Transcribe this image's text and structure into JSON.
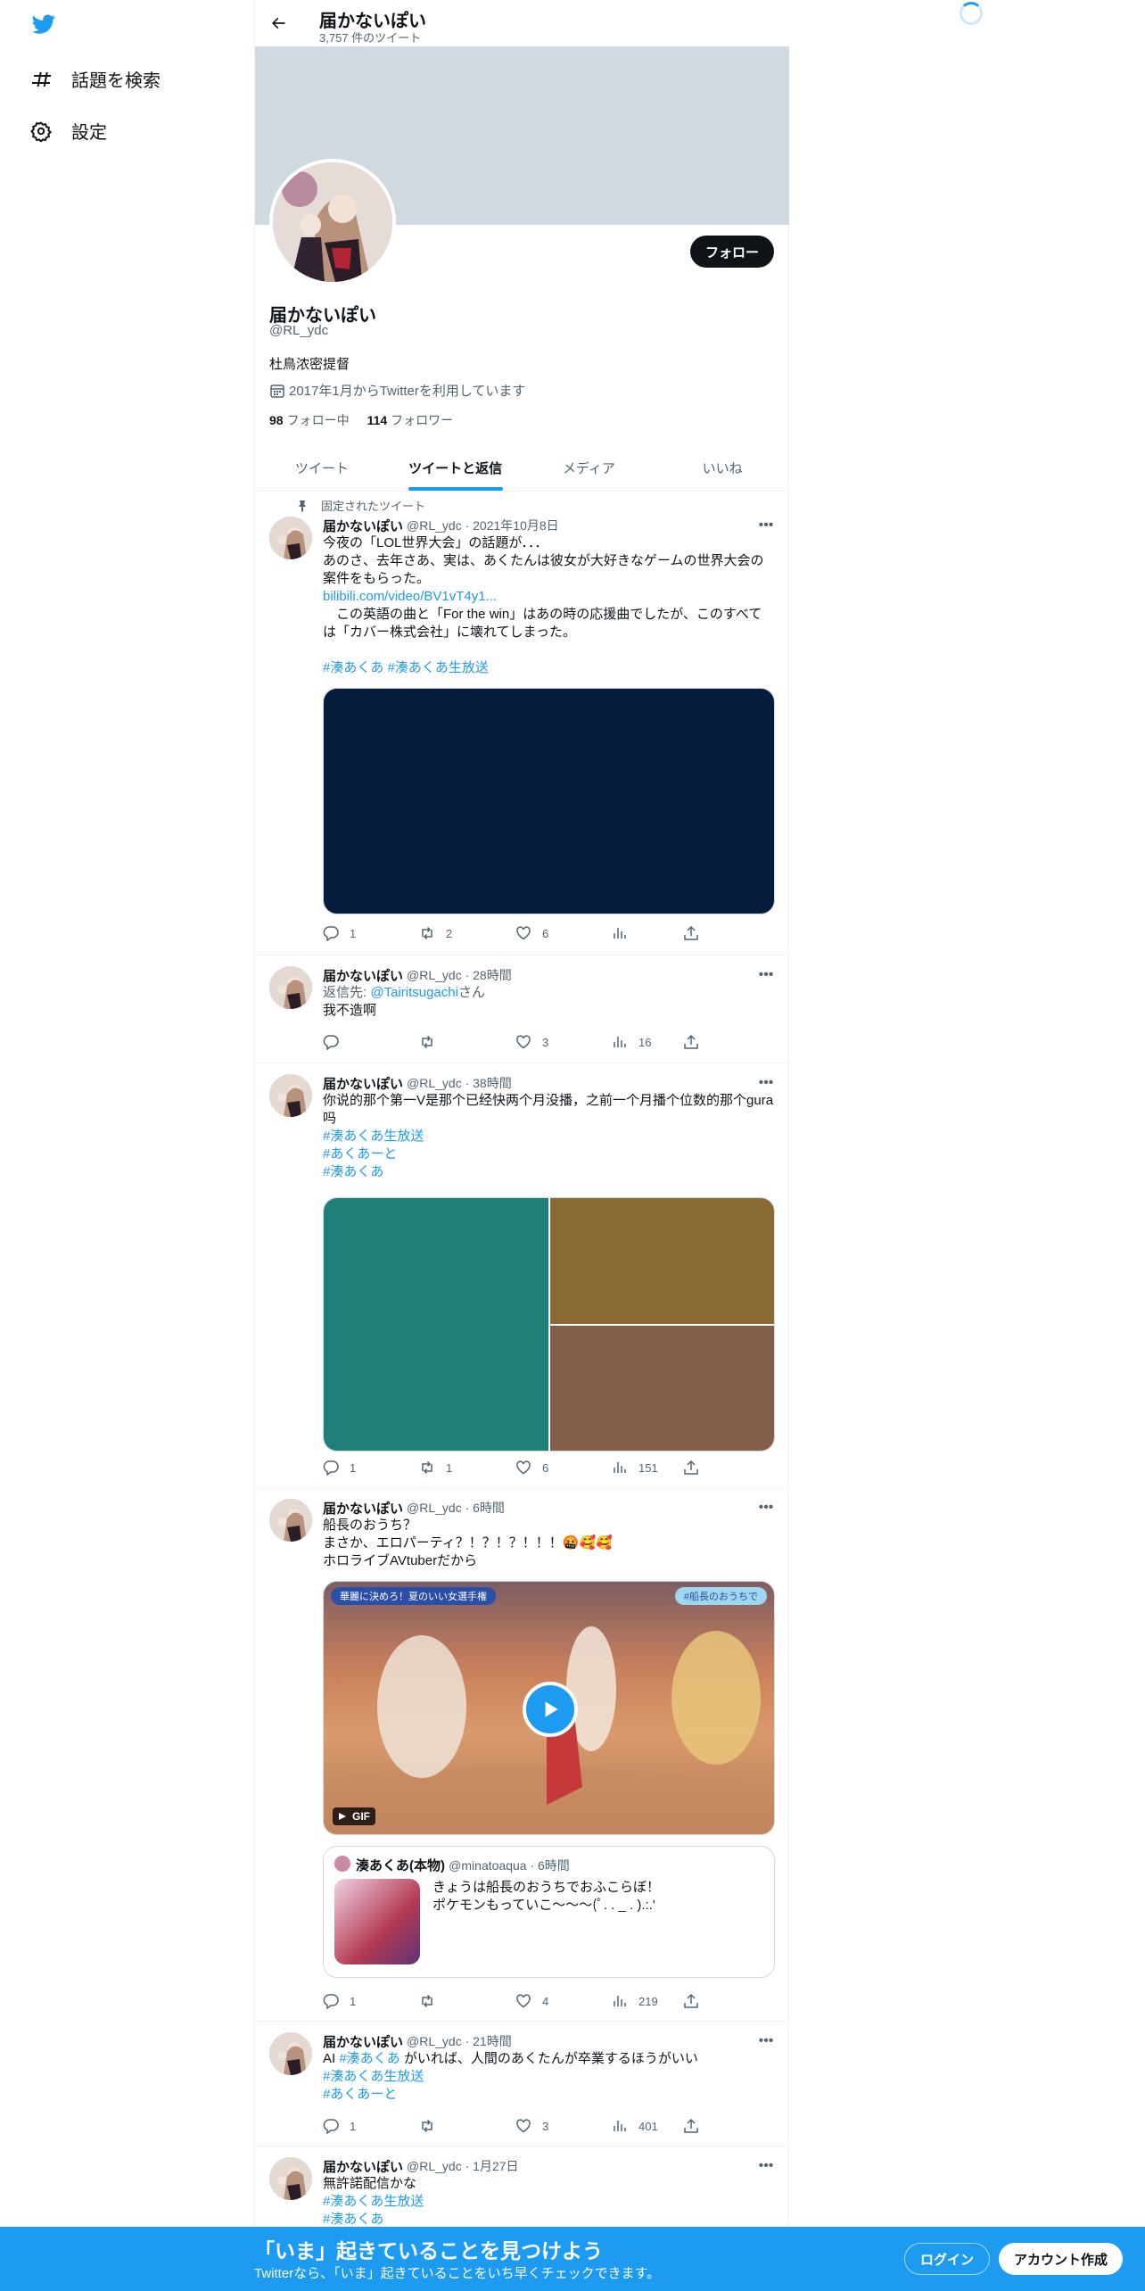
{
  "nav": {
    "explore_label": "話題を検索",
    "settings_label": "設定"
  },
  "header": {
    "name": "届かないぽい",
    "tweet_count": "3,757 件のツイート"
  },
  "profile": {
    "name": "届かないぽい",
    "handle": "@RL_ydc",
    "bio": "杜鳥浓密提督",
    "joined": "2017年1月からTwitterを利用しています",
    "following_count": "98",
    "following_label": "フォロー中",
    "followers_count": "114",
    "followers_label": "フォロワー",
    "follow_button": "フォロー"
  },
  "tabs": [
    "ツイート",
    "ツイートと返信",
    "メディア",
    "いいね"
  ],
  "active_tab": "ツイートと返信",
  "tweets": [
    {
      "pinned_label": "固定されたツイート",
      "name": "届かないぽい",
      "meta": "@RL_ydc · 2021年10月8日",
      "lines": [
        "今夜の「LOL世界大会」の話題が．．．",
        "あのさ、去年さあ、実は、あくたんは彼女が大好きなゲームの世界大会の",
        "案件をもらった。"
      ],
      "link": "bilibili.com/video/BV1vT4y1...",
      "lines2": [
        "　この英語の曲と「For the win」はあの時の応援曲でしたが、このすべて",
        "は「カバー株式会社」に壊れてしまった。"
      ],
      "hashtags": "#湊あくあ #湊あくあ生放送",
      "reply": "1",
      "retweet": "2",
      "like": "6"
    },
    {
      "name": "届かないぽい",
      "meta": "@RL_ydc · 28時間",
      "reply_to_prefix": "返信先: ",
      "reply_to": "@Tairitsugachi",
      "reply_to_suffix": "さん",
      "text": "我不造啊",
      "like": "3",
      "views": "16"
    },
    {
      "name": "届かないぽい",
      "meta": "@RL_ydc · 38時間",
      "text1": "你说的那个第一V是那个已经快两个月没播，之前一个月播个位数的那个gura",
      "text2": "吗",
      "tags": [
        "#湊あくあ生放送",
        "#あくあーと",
        "#湊あくあ"
      ],
      "reply": "1",
      "retweet": "1",
      "like": "6",
      "views": "151"
    },
    {
      "name": "届かないぽい",
      "meta": "@RL_ydc · 6時間",
      "lines": [
        "船長のおうち？",
        "まさか、エロパーティ？！？！？！！！🤬🥰🥰",
        "ホロライブAVtuberだから"
      ],
      "video_caption_left": "華麗に決めろ！夏のいい女選手権",
      "video_caption_right": "#船長のおうちで",
      "gif_label": "GIF",
      "quote_name": "湊あくあ(本物)",
      "quote_meta": "@minatoaqua · 6時間",
      "quote_line1": "きょうは船長のおうちでおふこらぼ！",
      "quote_line2": "ポケモンもっていこ〜〜〜(ﾟ. . _ . ).:.'",
      "reply": "1",
      "like": "4",
      "views": "219"
    },
    {
      "name": "届かないぽい",
      "meta": "@RL_ydc · 21時間",
      "text_prefix": "AI ",
      "text_tag": "#湊あくあ",
      "text_suffix": " がいれば、人間のあくたんが卒業するほうがいい",
      "tags": [
        "#湊あくあ生放送",
        "#あくあーと"
      ],
      "reply": "1",
      "like": "3",
      "views": "401"
    },
    {
      "name": "届かないぽい",
      "meta": "@RL_ydc · 1月27日",
      "text": "無許諾配信かな",
      "tags": [
        "#湊あくあ生放送",
        "#湊あくあ"
      ]
    }
  ],
  "bottom_bar": {
    "title": "「いま」起きていることを見つけよう",
    "subtitle": "Twitterなら、「いま」起きていることをいち早くチェックできます。",
    "login": "ログイン",
    "signup": "アカウント作成"
  },
  "colors": {
    "accent": "#1d9bf0",
    "text": "#0f1419",
    "muted": "#536471",
    "banner": "#cfd9de"
  }
}
